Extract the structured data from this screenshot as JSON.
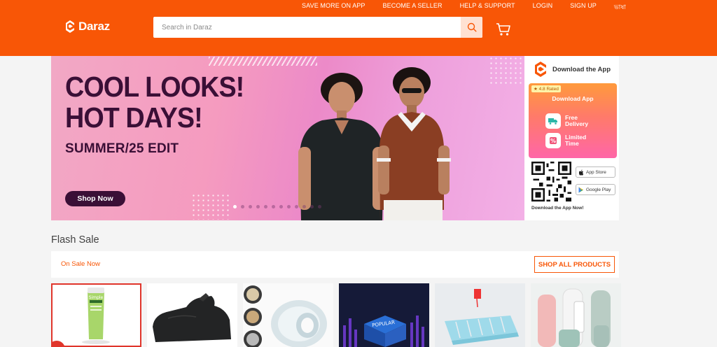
{
  "header": {
    "top_links": [
      "SAVE MORE ON APP",
      "BECOME A SELLER",
      "HELP & SUPPORT",
      "LOGIN",
      "SIGN UP",
      "ভাষা"
    ],
    "logo_text": "Daraz",
    "search_placeholder": "Search in Daraz",
    "brand_color": "#f85606",
    "icons": [
      "daraz-logo-icon",
      "search-icon",
      "cart-icon"
    ]
  },
  "hero": {
    "headline_1": "COOL LOOKS!",
    "headline_2": "HOT DAYS!",
    "subtitle": "SUMMER/25 EDIT",
    "button": "Shop Now",
    "slides_total": 12,
    "active_slide": 1
  },
  "app_panel": {
    "title": "Download the App",
    "rating": "4.8 Rated",
    "download_label": "Download App",
    "perks": [
      "Free Delivery",
      "Limited Time"
    ],
    "app_store": "App Store",
    "google_play": "Google Play",
    "footer": "Download the App Now!"
  },
  "flash_sale": {
    "title": "Flash Sale",
    "on_sale": "On Sale Now",
    "shop_all": "SHOP ALL PRODUCTS",
    "products": [
      {
        "name": "face-wash-tube",
        "brand_text": "Simple"
      },
      {
        "name": "bike-cover"
      },
      {
        "name": "double-sided-tape"
      },
      {
        "name": "pop-it-toy",
        "brand_text": "POPULAR"
      },
      {
        "name": "wall-shelf-rack"
      },
      {
        "name": "toothbrush-holder-cups"
      }
    ]
  }
}
